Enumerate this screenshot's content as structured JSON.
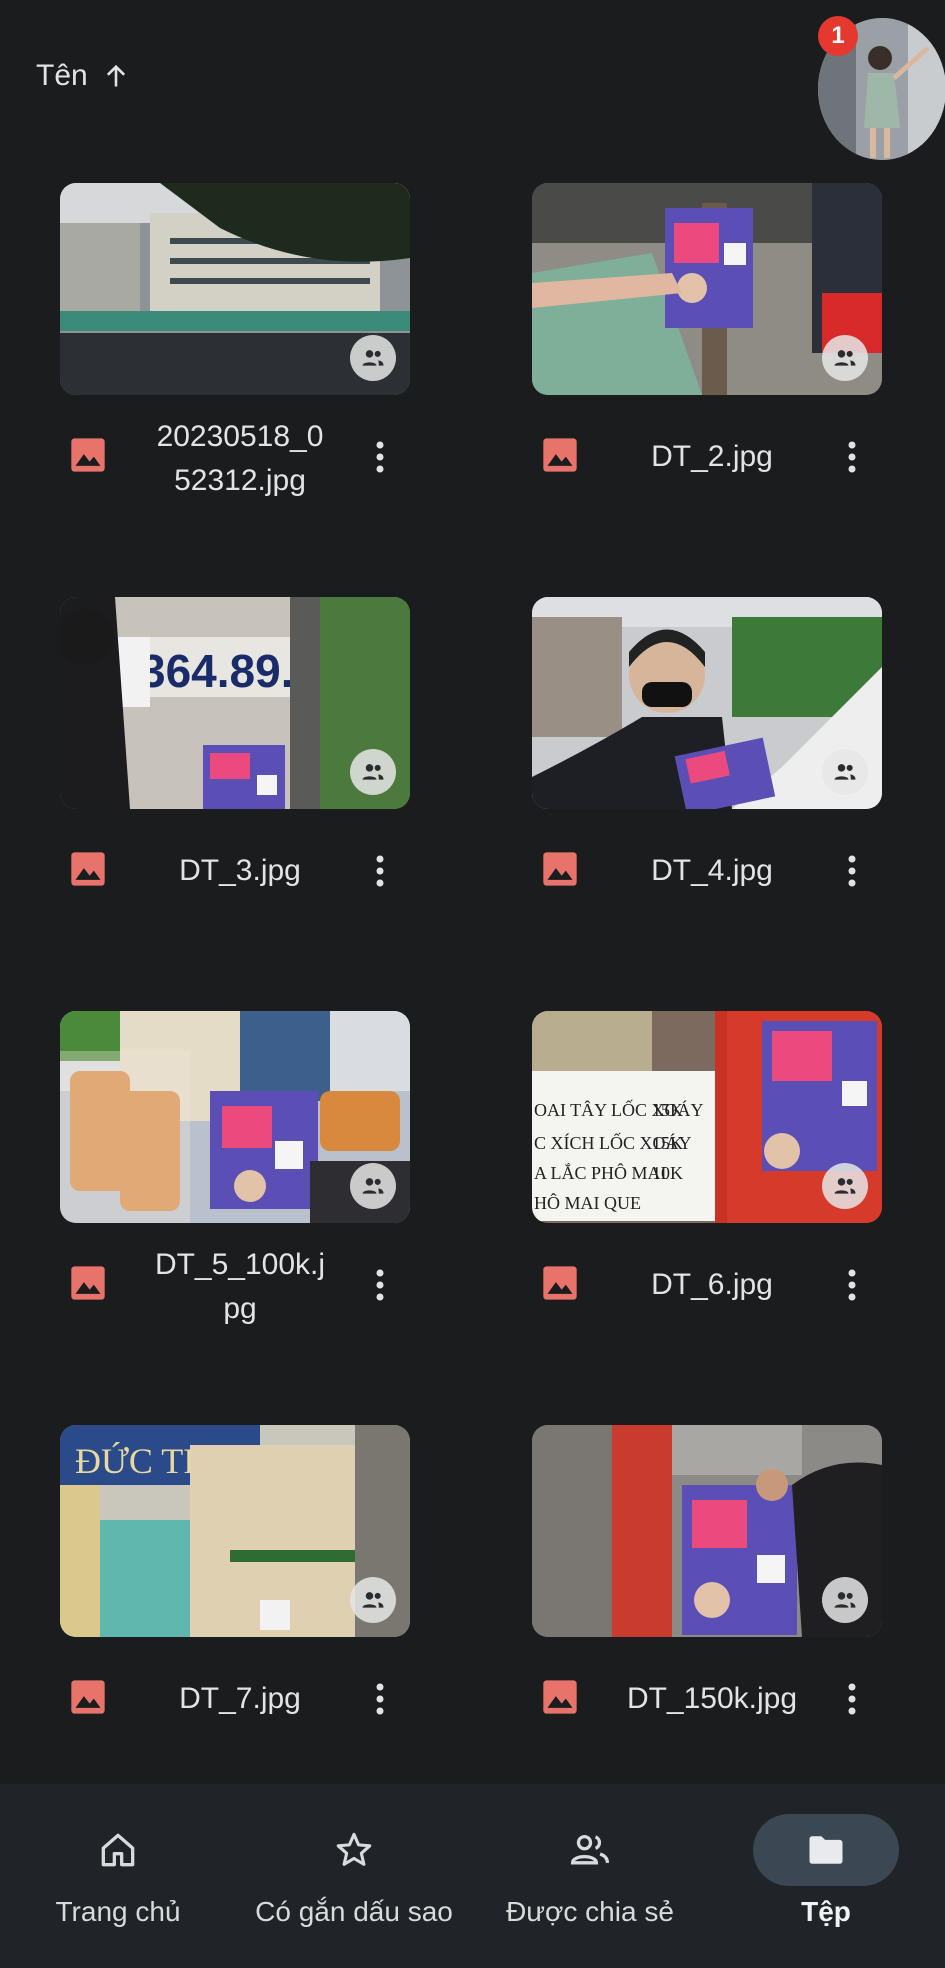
{
  "header": {
    "sort_label": "Tên",
    "sort_icon": "arrow-up-icon",
    "notification_count": "1"
  },
  "files": [
    {
      "name": "20230518_052312.jpg",
      "display": "20230518_0\n52312.jpg",
      "shared": true
    },
    {
      "name": "DT_2.jpg",
      "display": "DT_2.jpg",
      "shared": true
    },
    {
      "name": "DT_3.jpg",
      "display": "DT_3.jpg",
      "shared": true
    },
    {
      "name": "DT_4.jpg",
      "display": "DT_4.jpg",
      "shared": true
    },
    {
      "name": "DT_5_100k.jpg",
      "display": "DT_5_100k.j\npg",
      "shared": true
    },
    {
      "name": "DT_6.jpg",
      "display": "DT_6.jpg",
      "shared": true
    },
    {
      "name": "DT_7.jpg",
      "display": "DT_7.jpg",
      "shared": true
    },
    {
      "name": "DT_150k.jpg",
      "display": "DT_150k.jpg",
      "shared": true
    }
  ],
  "nav": {
    "items": [
      {
        "label": "Trang chủ",
        "icon": "home-icon"
      },
      {
        "label": "Có gắn dấu sao",
        "icon": "star-icon"
      },
      {
        "label": "Được chia sẻ",
        "icon": "people-icon"
      },
      {
        "label": "Tệp",
        "icon": "folder-icon",
        "active": true
      }
    ]
  },
  "colors": {
    "background": "#1a1c1e",
    "image_icon": "#e8736b",
    "badge": "#e5392f",
    "nav_background": "#202428",
    "nav_active_pill": "#3b4752"
  }
}
